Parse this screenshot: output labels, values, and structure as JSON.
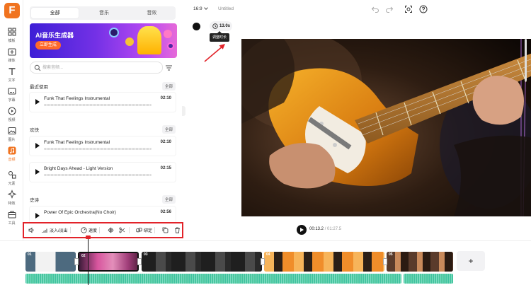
{
  "app": {
    "logo_letter": "F",
    "accent_color": "#f0731f",
    "highlight_color": "#e2232a"
  },
  "rail": {
    "items": [
      {
        "label": "模板",
        "icon": "template-icon"
      },
      {
        "label": "媒体",
        "icon": "media-icon"
      },
      {
        "label": "文字",
        "icon": "text-icon"
      },
      {
        "label": "字幕",
        "icon": "subtitle-icon"
      },
      {
        "label": "视频",
        "icon": "video-icon"
      },
      {
        "label": "图片",
        "icon": "image-icon"
      },
      {
        "label": "音频",
        "icon": "audio-icon",
        "active": true
      },
      {
        "label": "元素",
        "icon": "elements-icon"
      },
      {
        "label": "特效",
        "icon": "effects-icon"
      },
      {
        "label": "工具",
        "icon": "tools-icon"
      }
    ]
  },
  "library": {
    "tabs": [
      "全部",
      "音乐",
      "音效"
    ],
    "active_tab": "全部",
    "banner": {
      "title": "AI音乐生成器",
      "button": "立即生成"
    },
    "search_placeholder": "搜索音频...",
    "sections": [
      {
        "title": "最近使用",
        "all": "全部",
        "tracks": [
          {
            "name": "Funk That Feelings Instrumental",
            "duration": "02:10"
          }
        ]
      },
      {
        "title": "欢快",
        "all": "全部",
        "tracks": [
          {
            "name": "Funk That Feelings Instrumental",
            "duration": "02:10"
          },
          {
            "name": "Bright Days Ahead - Light Version",
            "duration": "02:15"
          }
        ]
      },
      {
        "title": "史诗",
        "all": "全部",
        "tracks": [
          {
            "name": "Power Of Epic Orchestra(No Choir)",
            "duration": "02:56"
          }
        ]
      }
    ]
  },
  "topbar": {
    "ratio": "16:9",
    "title": "Untitled"
  },
  "canvas": {
    "duration_button": "13.0s",
    "tooltip": "调整时长"
  },
  "playback": {
    "current": "00:13.2",
    "separator": " / ",
    "total": "01:27.5"
  },
  "clip_toolbar": {
    "fade": "淡入/淡出",
    "speed": "速度",
    "bind": "绑定"
  },
  "timeline": {
    "clips": [
      "01",
      "02",
      "03",
      "04",
      "05"
    ],
    "add": "+"
  }
}
